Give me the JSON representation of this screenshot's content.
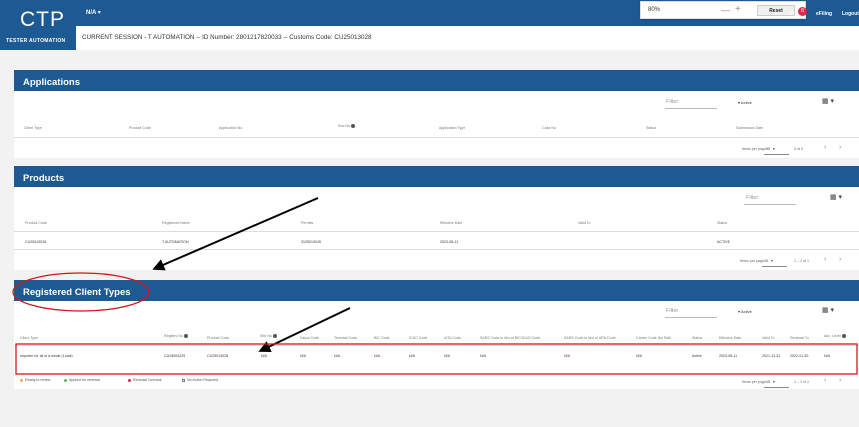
{
  "header": {
    "logo_big": "CTP",
    "logo_small": "TESTER AUTOMATION",
    "nla_menu": "N/A ▾",
    "zoom": {
      "level": "80%",
      "minus": "—",
      "plus": "+",
      "reset": "Reset"
    },
    "info_label": "Info",
    "info_badge": "8",
    "efiling": "eFiling",
    "logout": "Logout",
    "session": "CURRENT SESSION - T AUTOMATION -- ID Number: 2801217820033 -- Customs Code: CU25013028"
  },
  "applications": {
    "title": "Applications",
    "filter": "Filter",
    "status_filter": "Active",
    "columns": [
      "Client Type",
      "Product Code",
      "Application No",
      "Sub No",
      "Application Type",
      "Case No",
      "Status",
      "Submission Date"
    ],
    "pager": {
      "label": "Items per page:",
      "value": "50",
      "range": "0 of 0",
      "prev": "‹",
      "next": "›"
    }
  },
  "products": {
    "title": "Products",
    "filter": "Filter",
    "columns": [
      "Product Code",
      "Registered Name",
      "Permits",
      "Effective Date",
      "Valid To",
      "Status"
    ],
    "rows": [
      [
        "CU25013028",
        "T AUTOMATION",
        "3125013045",
        "2023-08-11",
        "",
        "ACTIVE"
      ]
    ],
    "pager": {
      "label": "Items per page:",
      "value": "10",
      "range": "1 – 1 of 1",
      "prev": "‹",
      "next": "›"
    }
  },
  "registered": {
    "title": "Registered Client Types",
    "filter": "Filter",
    "status_filter": "Active",
    "columns": [
      "Client Type",
      "Registry No",
      "Product Code",
      "Site No",
      "Depot Code",
      "Terminal Code",
      "BIC Code",
      "ICAO Code",
      "IATA Code",
      "SARS Code in lieu of BIC/ICAO Code",
      "SARS Code in lieu of IATA Code",
      "Carrier Code (for Rail)",
      "Status",
      "Effective Date",
      "Valid To",
      "Renewal To",
      "Acc. Level"
    ],
    "rows": [
      [
        "Importer for all of a whole (Local)",
        "CU25004229",
        "CU25013028",
        "N/A",
        "N/A",
        "N/A",
        "N/A",
        "N/A",
        "N/A",
        "N/A",
        "N/A",
        "N/A",
        "Active",
        "2023-08-11",
        "2021-12-31",
        "2022-01-30",
        "N/A"
      ]
    ],
    "legend": [
      "Ready to renew",
      "Applied for renewal",
      "Renewal Overdue",
      "No Action Required"
    ],
    "legend_colors": [
      "#f4a460",
      "#5cb85c",
      "#e0284f",
      "#ffffff"
    ],
    "pager": {
      "label": "Items per page:",
      "value": "10",
      "range": "1 – 1 of 1",
      "prev": "‹",
      "next": "›"
    }
  }
}
